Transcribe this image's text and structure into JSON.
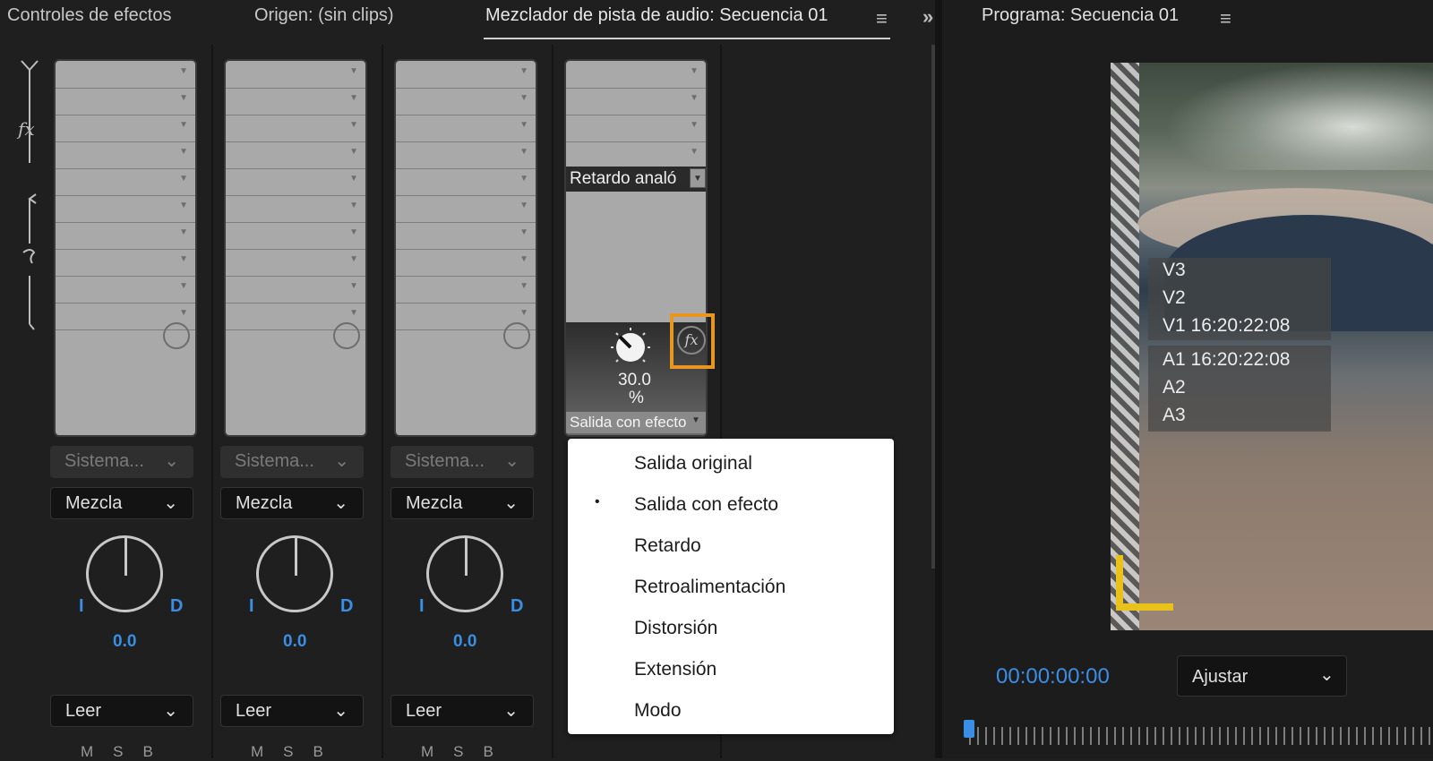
{
  "tabs": {
    "effect_controls": "Controles de efectos",
    "source": "Origen: (sin clips)",
    "audio_mixer": "Mezclador de pista de audio: Secuencia 01",
    "program": "Programa: Secuencia 01"
  },
  "rail": {
    "fx_label": "fx"
  },
  "tracks": [
    {
      "output": "Sistema...",
      "mix": "Mezcla",
      "pan_value": "0.0",
      "pan_left": "I",
      "pan_right": "D",
      "automation": "Leer",
      "msb": "MSB"
    },
    {
      "output": "Sistema...",
      "mix": "Mezcla",
      "pan_value": "0.0",
      "pan_left": "I",
      "pan_right": "D",
      "automation": "Leer",
      "msb": "MSB"
    },
    {
      "output": "Sistema...",
      "mix": "Mezcla",
      "pan_value": "0.0",
      "pan_left": "I",
      "pan_right": "D",
      "automation": "Leer",
      "msb": "MSB"
    }
  ],
  "fx_track": {
    "effect_name": "Retardo analó",
    "knob_value": "30.0",
    "knob_unit": "%",
    "param_label": "Salida con efecto",
    "fx_icon": "fx"
  },
  "menu": {
    "items": [
      "Salida original",
      "Salida con efecto",
      "Retardo",
      "Retroalimentación",
      "Distorsión",
      "Extensión",
      "Modo"
    ],
    "selected_index": 1,
    "bullet": "•"
  },
  "program": {
    "overlay_top": [
      "V3",
      "V2",
      "V1 16:20:22:08"
    ],
    "overlay_bottom": [
      "A1 16:20:22:08",
      "A2",
      "A3"
    ],
    "timecode": "00:00:00:00",
    "fit": "Ajustar"
  },
  "colors": {
    "accent_blue": "#3a8ee6",
    "highlight_orange": "#e8961e",
    "marker_yellow": "#e8c21a"
  }
}
